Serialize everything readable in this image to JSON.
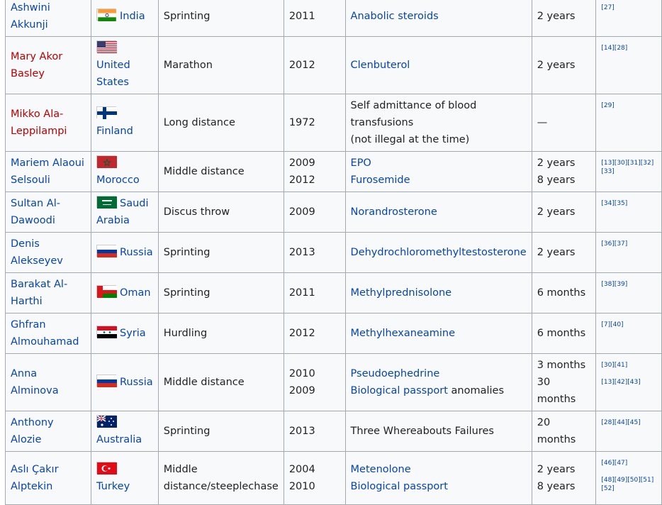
{
  "rows": [
    {
      "name": "Ashwini Akkunji",
      "name_red": false,
      "country": "India",
      "flag": "india",
      "event": "Sprinting",
      "years": [
        "2011"
      ],
      "subs": [
        [
          "Anabolic steroids"
        ]
      ],
      "bans": [
        "2 years"
      ],
      "refs": [
        "[27]"
      ]
    },
    {
      "name": "Mary Akor Basley",
      "name_red": true,
      "country": "United States",
      "flag": "usa",
      "event": "Marathon",
      "years": [
        "2012"
      ],
      "subs": [
        [
          "Clenbuterol"
        ]
      ],
      "bans": [
        "2 years"
      ],
      "refs": [
        "[14][28]"
      ]
    },
    {
      "name": "Mikko Ala-Leppilampi",
      "name_red": true,
      "country": "Finland",
      "flag": "finland",
      "event": "Long distance",
      "years": [
        "1972"
      ],
      "subs_plain": [
        "Self admittance of blood",
        "transfusions",
        "(not illegal at the time)"
      ],
      "bans": [
        "—"
      ],
      "refs": [
        "[29]"
      ]
    },
    {
      "name": "Mariem Alaoui Selsouli",
      "name_red": false,
      "country": "Morocco",
      "flag": "morocco",
      "event": "Middle distance",
      "years": [
        "2009",
        "2012"
      ],
      "subs": [
        [
          "EPO"
        ],
        [
          "Furosemide"
        ]
      ],
      "bans": [
        "2 years",
        "8 years"
      ],
      "refs": [
        "[13][30][31][32][33]"
      ]
    },
    {
      "name": "Sultan Al-Dawoodi",
      "name_red": false,
      "country": "Saudi Arabia",
      "flag": "saudi",
      "event": "Discus throw",
      "years": [
        "2009"
      ],
      "subs": [
        [
          "Norandrosterone"
        ]
      ],
      "bans": [
        "2 years"
      ],
      "refs": [
        "[34][35]"
      ]
    },
    {
      "name": "Denis Alekseyev",
      "name_red": false,
      "country": "Russia",
      "flag": "russia",
      "event": "Sprinting",
      "years": [
        "2013"
      ],
      "subs": [
        [
          "Dehydrochloromethyltestosterone"
        ]
      ],
      "bans": [
        "2 years"
      ],
      "refs": [
        "[36][37]"
      ]
    },
    {
      "name": "Barakat Al-Harthi",
      "name_red": false,
      "country": "Oman",
      "flag": "oman",
      "event": "Sprinting",
      "years": [
        "2011"
      ],
      "subs": [
        [
          "Methylprednisolone"
        ]
      ],
      "bans": [
        "6 months"
      ],
      "refs": [
        "[38][39]"
      ]
    },
    {
      "name": "Ghfran Almouhamad",
      "name_red": false,
      "country": "Syria",
      "flag": "syria",
      "event": "Hurdling",
      "years": [
        "2012"
      ],
      "subs": [
        [
          "Methylhexaneamine"
        ]
      ],
      "bans": [
        "6 months"
      ],
      "refs": [
        "[7][40]"
      ]
    },
    {
      "name": "Anna Alminova",
      "name_red": false,
      "country": "Russia",
      "flag": "russia",
      "event": "Middle distance",
      "years": [
        "2010",
        "2009"
      ],
      "subs": [
        [
          "Pseudoephedrine"
        ],
        [
          "Biological passport",
          " anomalies"
        ]
      ],
      "bans": [
        "3 months",
        "30 months"
      ],
      "refs": [
        "[30][41]",
        "[13][42][43]"
      ]
    },
    {
      "name": "Anthony Alozie",
      "name_red": false,
      "country": "Australia",
      "flag": "australia",
      "event": "Sprinting",
      "years": [
        "2013"
      ],
      "subs_plain": [
        "Three Whereabouts Failures"
      ],
      "bans": [
        "20 months"
      ],
      "refs": [
        "[28][44][45]"
      ]
    },
    {
      "name": "Aslı Çakır Alptekin",
      "name_red": false,
      "country": "Turkey",
      "flag": "turkey",
      "event": "Middle distance/steeplechase",
      "years": [
        "2004",
        "2010"
      ],
      "subs": [
        [
          "Metenolone"
        ],
        [
          "Biological passport"
        ]
      ],
      "bans": [
        "2 years",
        "8 years"
      ],
      "refs": [
        "[46][47]",
        "[48][49][50][51][52]"
      ]
    }
  ]
}
